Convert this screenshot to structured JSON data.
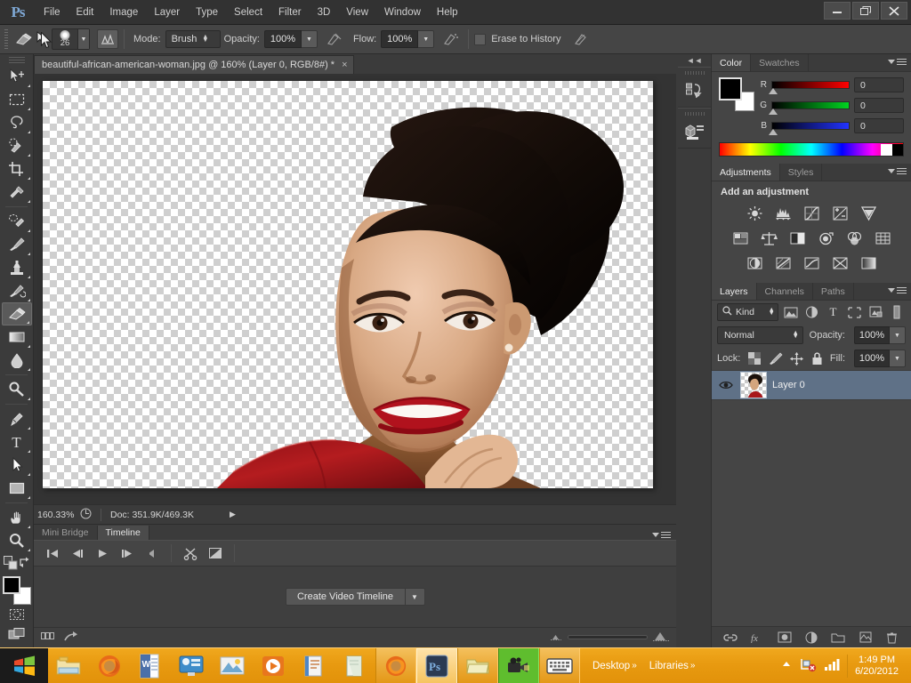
{
  "app": {
    "logo": "Ps",
    "title": "Adobe Photoshop"
  },
  "menubar": {
    "items": [
      "File",
      "Edit",
      "Image",
      "Layer",
      "Type",
      "Select",
      "Filter",
      "3D",
      "View",
      "Window",
      "Help"
    ]
  },
  "window_controls": {
    "minimize": "minimize-icon",
    "restore": "restore-icon",
    "close": "close-icon"
  },
  "options_bar": {
    "tool_icon": "eraser-tool-icon",
    "brush_size": "26",
    "brush_preset_icon": "soft-round-brush-icon",
    "brush_panel_icon": "toggle-brush-panel-icon",
    "mode_label": "Mode:",
    "mode_value": "Brush",
    "opacity_label": "Opacity:",
    "opacity_value": "100%",
    "opacity_pressure_icon": "tablet-pressure-opacity-icon",
    "flow_label": "Flow:",
    "flow_value": "100%",
    "airbrush_icon": "airbrush-icon",
    "erase_to_history_label": "Erase to History",
    "erase_to_history_checked": false,
    "pressure_icon": "tablet-pressure-size-icon"
  },
  "toolbox": {
    "tools": [
      {
        "name": "move-tool",
        "selected": false
      },
      {
        "name": "rectangular-marquee-tool",
        "selected": false
      },
      {
        "name": "lasso-tool",
        "selected": false
      },
      {
        "name": "quick-selection-tool",
        "selected": false
      },
      {
        "name": "crop-tool",
        "selected": false
      },
      {
        "name": "eyedropper-tool",
        "selected": false
      },
      {
        "name": "spot-healing-brush-tool",
        "selected": false
      },
      {
        "name": "brush-tool",
        "selected": false
      },
      {
        "name": "clone-stamp-tool",
        "selected": false
      },
      {
        "name": "history-brush-tool",
        "selected": false
      },
      {
        "name": "eraser-tool",
        "selected": true
      },
      {
        "name": "gradient-tool",
        "selected": false
      },
      {
        "name": "blur-tool",
        "selected": false
      },
      {
        "name": "dodge-tool",
        "selected": false
      },
      {
        "name": "pen-tool",
        "selected": false
      },
      {
        "name": "horizontal-type-tool",
        "selected": false
      },
      {
        "name": "path-selection-tool",
        "selected": false
      },
      {
        "name": "rectangle-tool",
        "selected": false
      },
      {
        "name": "hand-tool",
        "selected": false
      },
      {
        "name": "zoom-tool",
        "selected": false
      }
    ],
    "type_tool_glyph": "T",
    "default_colors_icon": "default-foreground-background-icon",
    "swap_colors_icon": "swap-foreground-background-icon",
    "foreground_color": "#000000",
    "background_color": "#ffffff",
    "quick_mask_icon": "edit-in-quick-mask-icon",
    "screen_mode_icon": "change-screen-mode-icon"
  },
  "document": {
    "tab_title": "beautiful-african-american-woman.jpg @ 160% (Layer 0, RGB/8#) *",
    "close_glyph": "×",
    "zoom_level": "160.33%",
    "doc_info": "Doc: 351.9K/469.3K",
    "status_arrow": "▶",
    "status_thumb_icon": "document-info-icon"
  },
  "timeline_panel": {
    "tabs": [
      {
        "label": "Mini Bridge",
        "active": false
      },
      {
        "label": "Timeline",
        "active": true
      }
    ],
    "transport": [
      "go-to-first-frame-icon",
      "previous-frame-icon",
      "play-icon",
      "next-frame-icon",
      "mute-audio-icon"
    ],
    "tools": [
      "split-at-playhead-icon",
      "transition-icon"
    ],
    "create_button_label": "Create Video Timeline",
    "create_dropdown_icon": "chevron-down-icon",
    "footer": {
      "convert_to_frame_animation_icon": "convert-to-frame-animation-icon",
      "render_video_icon": "render-video-icon",
      "zoom_out_icon": "zoom-out-thumbnails-icon",
      "zoom_in_icon": "zoom-in-thumbnails-icon"
    }
  },
  "icon_dock": {
    "collapse_icon": "collapse-to-icons-icon",
    "items": [
      "history-panel-icon",
      "properties-panel-icon"
    ]
  },
  "color_panel": {
    "tabs": [
      {
        "label": "Color",
        "active": true
      },
      {
        "label": "Swatches",
        "active": false
      }
    ],
    "menu_icon": "panel-menu-icon",
    "foreground_color": "#000000",
    "background_color": "#ffffff",
    "channels": [
      {
        "label": "R",
        "value": "0"
      },
      {
        "label": "G",
        "value": "0"
      },
      {
        "label": "B",
        "value": "0"
      }
    ]
  },
  "adjustments_panel": {
    "tabs": [
      {
        "label": "Adjustments",
        "active": true
      },
      {
        "label": "Styles",
        "active": false
      }
    ],
    "menu_icon": "panel-menu-icon",
    "heading": "Add an adjustment",
    "rows": [
      [
        "brightness-contrast-icon",
        "levels-icon",
        "curves-icon",
        "exposure-icon",
        "vibrance-icon"
      ],
      [
        "hue-saturation-icon",
        "color-balance-icon",
        "black-white-icon",
        "photo-filter-icon",
        "channel-mixer-icon",
        "color-lookup-icon"
      ],
      [
        "invert-icon",
        "posterize-icon",
        "threshold-icon",
        "gradient-map-icon",
        "selective-color-icon"
      ]
    ]
  },
  "layers_panel": {
    "tabs": [
      {
        "label": "Layers",
        "active": true
      },
      {
        "label": "Channels",
        "active": false
      },
      {
        "label": "Paths",
        "active": false
      }
    ],
    "menu_icon": "panel-menu-icon",
    "filter": {
      "search_icon": "search-icon",
      "kind_label": "Kind",
      "type_filters": [
        "filter-pixel-layers-icon",
        "filter-adjustment-layers-icon",
        "filter-type-layers-icon",
        "filter-shape-layers-icon",
        "filter-smart-objects-icon"
      ],
      "toggle_icon": "filter-toggle-icon"
    },
    "blend_mode": "Normal",
    "opacity_label": "Opacity:",
    "opacity_value": "100%",
    "lock_label": "Lock:",
    "lock_icons": [
      "lock-transparent-pixels-icon",
      "lock-image-pixels-icon",
      "lock-position-icon",
      "lock-all-icon"
    ],
    "fill_label": "Fill:",
    "fill_value": "100%",
    "layers": [
      {
        "name": "Layer 0",
        "visible": true,
        "selected": true,
        "visibility_icon": "eye-icon",
        "thumbnail": "layer-thumbnail"
      }
    ],
    "footer_icons": [
      "link-layers-icon",
      "layer-style-icon",
      "layer-mask-icon",
      "new-fill-adjustment-layer-icon",
      "new-group-icon",
      "new-layer-icon",
      "delete-layer-icon"
    ]
  },
  "taskbar": {
    "start_icon": "windows-start-icon",
    "pinned": [
      "windows-explorer-icon",
      "firefox-icon",
      "microsoft-word-icon",
      "control-panel-icon",
      "photo-gallery-icon",
      "media-player-icon",
      "presentation-icon",
      "notepad-icon"
    ],
    "running": [
      {
        "icon": "firefox-icon",
        "state": "running"
      },
      {
        "icon": "photoshop-icon",
        "state": "active"
      },
      {
        "icon": "folder-icon",
        "state": "running"
      },
      {
        "icon": "camtasia-recorder-icon",
        "state": "recording"
      },
      {
        "icon": "onscreen-keyboard-icon",
        "state": "running"
      }
    ],
    "toolbar_items": [
      {
        "label": "Desktop",
        "chevron": "»"
      },
      {
        "label": "Libraries",
        "chevron": "»"
      }
    ],
    "tray": {
      "show_hidden_icon": "show-hidden-icons-icon",
      "network_icon": "network-disconnected-icon",
      "volume_icon": "volume-icon"
    },
    "clock": {
      "time": "1:49 PM",
      "date": "6/20/2012"
    }
  }
}
